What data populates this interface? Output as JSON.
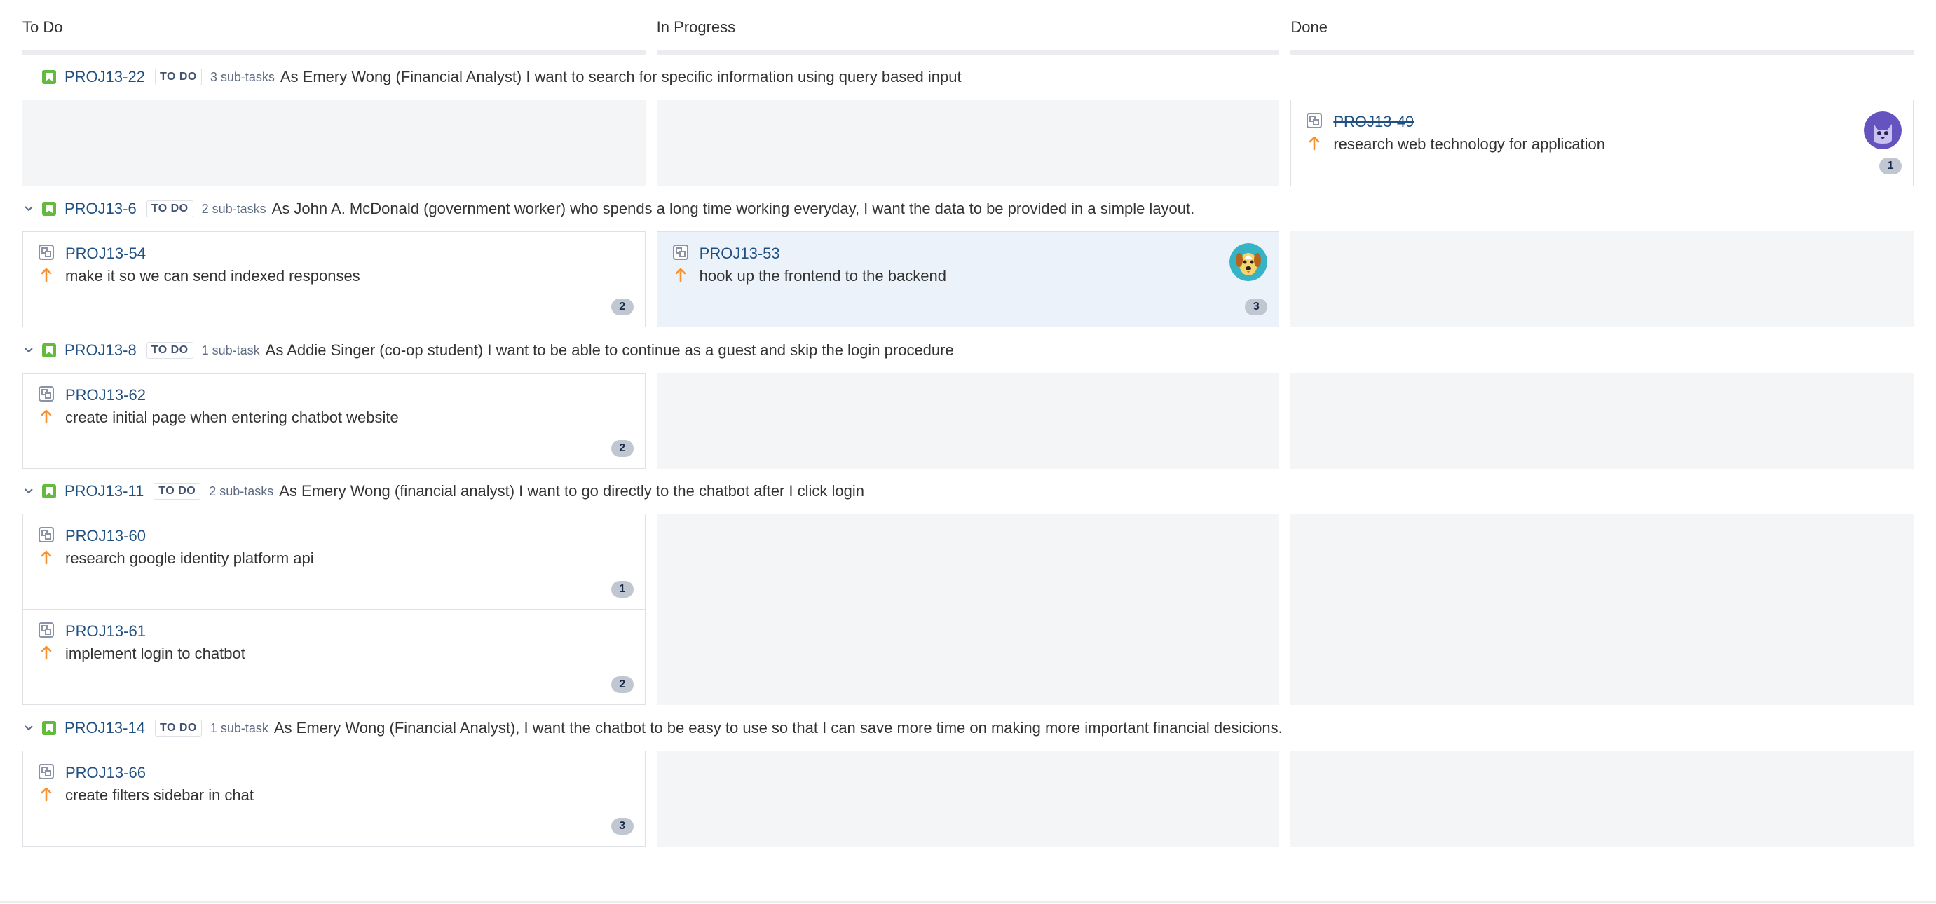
{
  "columns": [
    "To Do",
    "In Progress",
    "Done"
  ],
  "swimlanes": [
    {
      "key": "PROJ13-22",
      "status": "TO DO",
      "subtasks": "3 sub-tasks",
      "summary": "As Emery Wong (Financial Analyst) I want to search for specific information using query based input",
      "cards": {
        "todo": [],
        "inprogress": [],
        "done": [
          {
            "key": "PROJ13-49",
            "summary": "research web technology for application",
            "estimate": "1",
            "avatar": "cat-avatar"
          }
        ]
      }
    },
    {
      "key": "PROJ13-6",
      "status": "TO DO",
      "subtasks": "2 sub-tasks",
      "summary": "As John A. McDonald (government worker) who spends a long time working everyday, I want the data to be provided in a simple layout.",
      "cards": {
        "todo": [
          {
            "key": "PROJ13-54",
            "summary": "make it so we can send indexed responses",
            "estimate": "2"
          }
        ],
        "inprogress": [
          {
            "key": "PROJ13-53",
            "summary": "hook up the frontend to the backend",
            "estimate": "3",
            "avatar": "dog-avatar"
          }
        ],
        "done": []
      }
    },
    {
      "key": "PROJ13-8",
      "status": "TO DO",
      "subtasks": "1 sub-task",
      "summary": "As Addie Singer (co-op student) I want to be able to continue as a guest and skip the login procedure",
      "cards": {
        "todo": [
          {
            "key": "PROJ13-62",
            "summary": "create initial page when entering chatbot website",
            "estimate": "2"
          }
        ],
        "inprogress": [],
        "done": []
      }
    },
    {
      "key": "PROJ13-11",
      "status": "TO DO",
      "subtasks": "2 sub-tasks",
      "summary": "As Emery Wong (financial analyst) I want to go directly to the chatbot after I click login",
      "cards": {
        "todo": [
          {
            "key": "PROJ13-60",
            "summary": "research google identity platform api",
            "estimate": "1"
          },
          {
            "key": "PROJ13-61",
            "summary": "implement login to chatbot",
            "estimate": "2"
          }
        ],
        "inprogress": [],
        "done": []
      }
    },
    {
      "key": "PROJ13-14",
      "status": "TO DO",
      "subtasks": "1 sub-task",
      "summary": "As Emery Wong (Financial Analyst), I want the chatbot to be easy to use so that I can save more time on making more important financial desicions.",
      "cards": {
        "todo": [
          {
            "key": "PROJ13-66",
            "summary": "create filters sidebar in chat",
            "estimate": "3"
          }
        ],
        "inprogress": [],
        "done": []
      }
    }
  ],
  "colors": {
    "link": "#205081",
    "story_green": "#63ba3c",
    "priority_orange": "#f79232",
    "column_bg": "#f4f5f7",
    "selected_card": "#ebf2f9"
  }
}
